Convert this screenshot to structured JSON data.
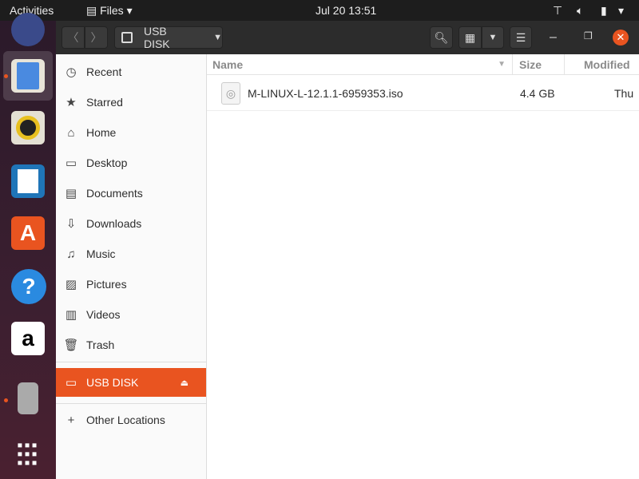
{
  "topbar": {
    "activities": "Activities",
    "app_menu": "Files",
    "clock": "Jul 20  13:51"
  },
  "dock": {
    "items": [
      "Thunderbird",
      "Files",
      "Rhythmbox",
      "LibreOffice Writer",
      "Ubuntu Software",
      "Help",
      "Amazon",
      "USB Disk",
      "Show Applications"
    ]
  },
  "header": {
    "location": "USB DISK"
  },
  "sidebar": {
    "items": [
      {
        "label": "Recent",
        "icon": "clock-icon"
      },
      {
        "label": "Starred",
        "icon": "star-icon"
      },
      {
        "label": "Home",
        "icon": "home-icon"
      },
      {
        "label": "Desktop",
        "icon": "desktop-icon"
      },
      {
        "label": "Documents",
        "icon": "document-icon"
      },
      {
        "label": "Downloads",
        "icon": "download-icon"
      },
      {
        "label": "Music",
        "icon": "music-icon"
      },
      {
        "label": "Pictures",
        "icon": "picture-icon"
      },
      {
        "label": "Videos",
        "icon": "video-icon"
      },
      {
        "label": "Trash",
        "icon": "trash-icon"
      }
    ],
    "device": "USB DISK",
    "other": "Other Locations"
  },
  "columns": {
    "name": "Name",
    "size": "Size",
    "modified": "Modified"
  },
  "files": [
    {
      "name": "M-LINUX-L-12.1.1-6959353.iso",
      "size": "4.4 GB",
      "modified": "Thu"
    }
  ],
  "colors": {
    "accent": "#e95420"
  }
}
